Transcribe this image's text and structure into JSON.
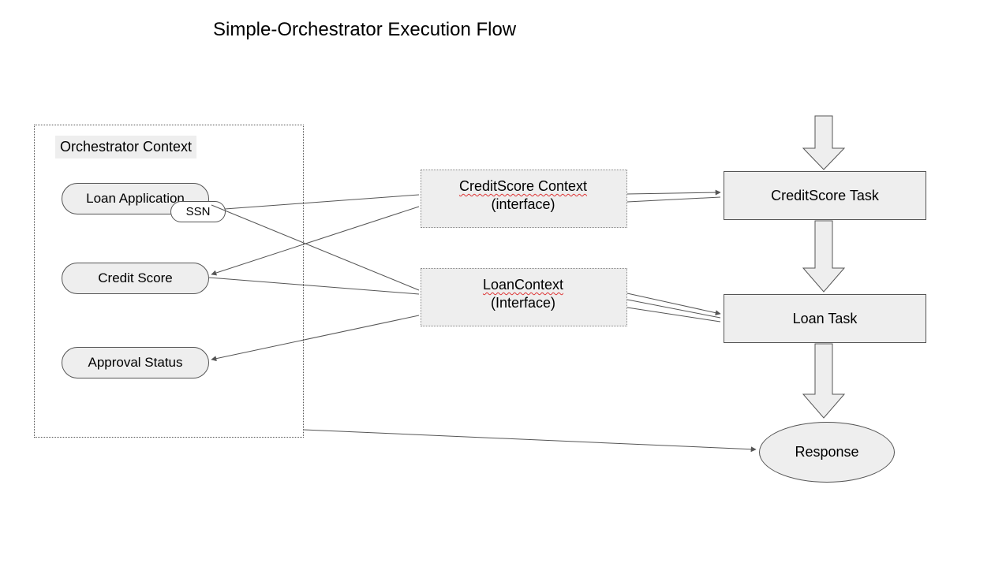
{
  "title": "Simple-Orchestrator Execution Flow",
  "orchestrator": {
    "label": "Orchestrator Context",
    "items": {
      "loan_app": "Loan Application",
      "ssn": "SSN",
      "credit_score": "Credit Score",
      "approval_status": "Approval Status"
    }
  },
  "contexts": {
    "credit_score": {
      "line1": "CreditScore Context",
      "line2": "(interface)"
    },
    "loan": {
      "line1": "LoanContext",
      "line2": "(Interface)"
    }
  },
  "tasks": {
    "credit_score": "CreditScore Task",
    "loan": "Loan Task"
  },
  "response": "Response"
}
